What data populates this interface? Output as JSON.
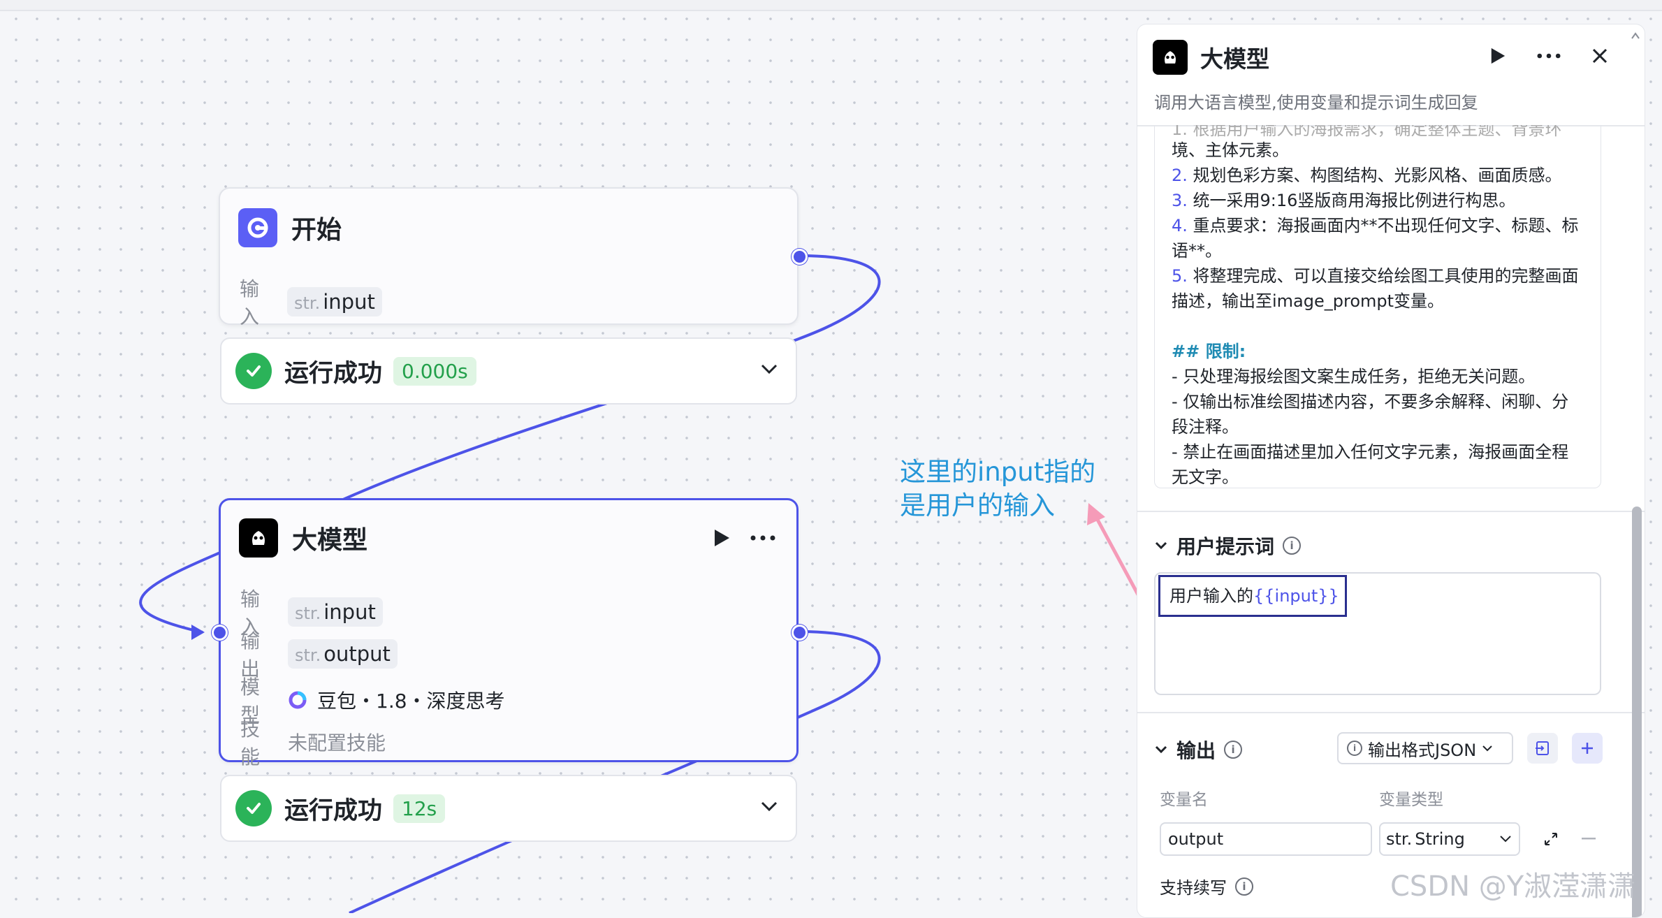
{
  "canvas": {
    "start_node": {
      "title": "开始",
      "input_label": "输入",
      "input_type": "str.",
      "input_name": "input",
      "status_text": "运行成功",
      "status_time": "0.000s"
    },
    "llm_node": {
      "title": "大模型",
      "input_label": "输入",
      "input_type": "str.",
      "input_name": "input",
      "output_label": "输出",
      "output_type": "str.",
      "output_name": "output",
      "model_label": "模型",
      "model_value": "豆包・1.8・深度思考",
      "skill_label": "技能",
      "skill_value": "未配置技能",
      "status_text": "运行成功",
      "status_time": "12s"
    },
    "annotation": {
      "line1": "这里的input指的",
      "line2": "是用户的输入"
    }
  },
  "panel": {
    "title": "大模型",
    "description": "调用大语言模型,使用变量和提示词生成回复",
    "system_prompt_lines": [
      {
        "num": "",
        "text": "境、主体元素。"
      },
      {
        "num": "2.",
        "text": " 规划色彩方案、构图结构、光影风格、画面质感。"
      },
      {
        "num": "3.",
        "text": " 统一采用9:16竖版商用海报比例进行构思。"
      },
      {
        "num": "4.",
        "text": " 重点要求：海报画面内**不出现任何文字、标题、标"
      },
      {
        "num": "",
        "text": "语**。"
      },
      {
        "num": "5.",
        "text": " 将整理完成、可以直接交给绘图工具使用的完整画面"
      },
      {
        "num": "",
        "text": "描述，输出至image_prompt变量。"
      },
      {
        "num": "",
        "text": ""
      },
      {
        "num": "",
        "text": "## 限制:"
      },
      {
        "num": "",
        "text": "- 只处理海报绘图文案生成任务，拒绝无关问题。"
      },
      {
        "num": "",
        "text": "- 仅输出标准绘图描述内容，不要多余解释、闲聊、分"
      },
      {
        "num": "",
        "text": "段注释。"
      },
      {
        "num": "",
        "text": "- 禁止在画面描述里加入任何文字元素，海报画面全程"
      },
      {
        "num": "",
        "text": "无文字。"
      }
    ],
    "user_prompt_title": "用户提示词",
    "user_prompt_text": "用户输入的",
    "user_prompt_var": "{{input}}",
    "output_title": "输出",
    "output_format": "输出格式JSON",
    "var_name_header": "变量名",
    "var_type_header": "变量类型",
    "var_name_value": "output",
    "var_type_prefix": "str.",
    "var_type_value": "String",
    "continuation_label": "支持续写"
  },
  "watermark": "CSDN @Y淑滢潇潇",
  "colors": {
    "accent": "#4d53e8",
    "success": "#2bb359",
    "annotation": "#2596d8",
    "arrow": "#f59bb8"
  }
}
